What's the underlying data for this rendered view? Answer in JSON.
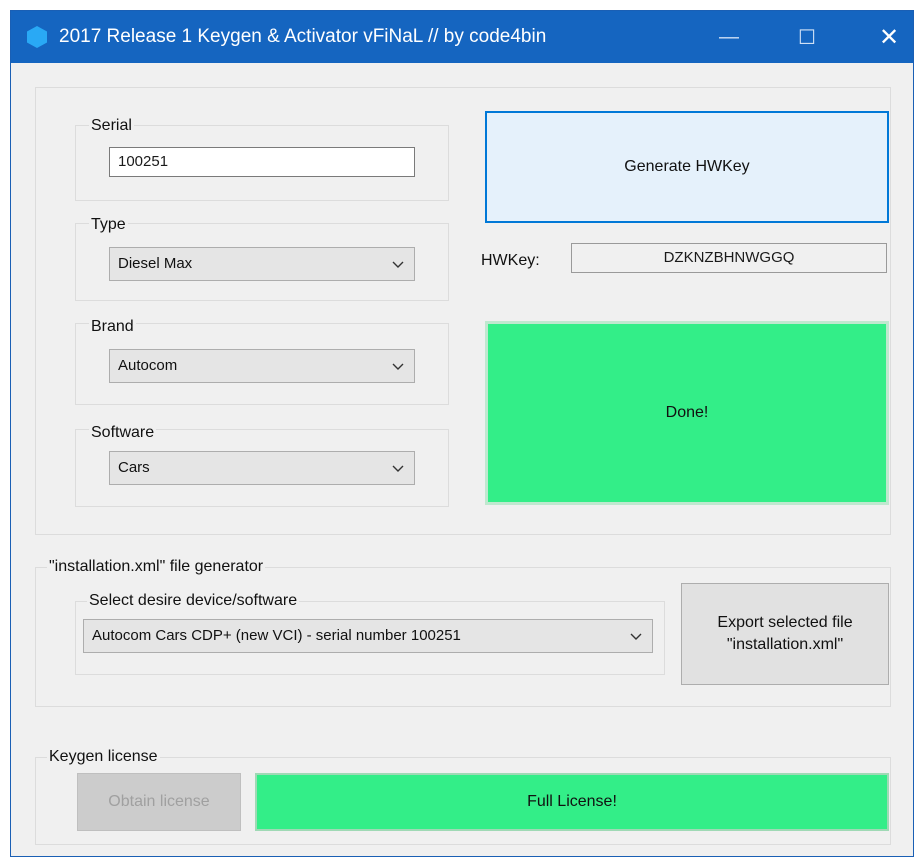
{
  "window": {
    "title": "2017 Release 1 Keygen & Activator vFiNaL // by code4bin",
    "minimize_glyph": "—",
    "maximize_glyph": "☐",
    "close_glyph": "✕"
  },
  "left": {
    "serial_label": "Serial",
    "serial_value": "100251",
    "type_label": "Type",
    "type_value": "Diesel Max",
    "brand_label": "Brand",
    "brand_value": "Autocom",
    "software_label": "Software",
    "software_value": "Cars"
  },
  "right": {
    "generate_button": "Generate HWKey",
    "hwkey_label": "HWKey:",
    "hwkey_value": "DZKNZBHNWGGQ",
    "status_text": "Done!"
  },
  "installation": {
    "section_title": "\"installation.xml\" file generator",
    "select_label": "Select desire device/software",
    "select_value": "Autocom Cars CDP+ (new VCI) - serial number 100251",
    "export_line1": "Export selected file",
    "export_line2": "\"installation.xml\""
  },
  "license": {
    "section_title": "Keygen license",
    "obtain_button": "Obtain license",
    "status_text": "Full License!"
  },
  "colors": {
    "titlebar": "#1565c0",
    "generate_bg": "#e5f1fb",
    "generate_border": "#0078d7",
    "success_green": "#33ee88",
    "disabled_bg": "#cccccc",
    "disabled_text": "#a0a0a0"
  },
  "icons": {
    "app": "hexagon-icon",
    "dropdown": "chevron-down-icon"
  }
}
